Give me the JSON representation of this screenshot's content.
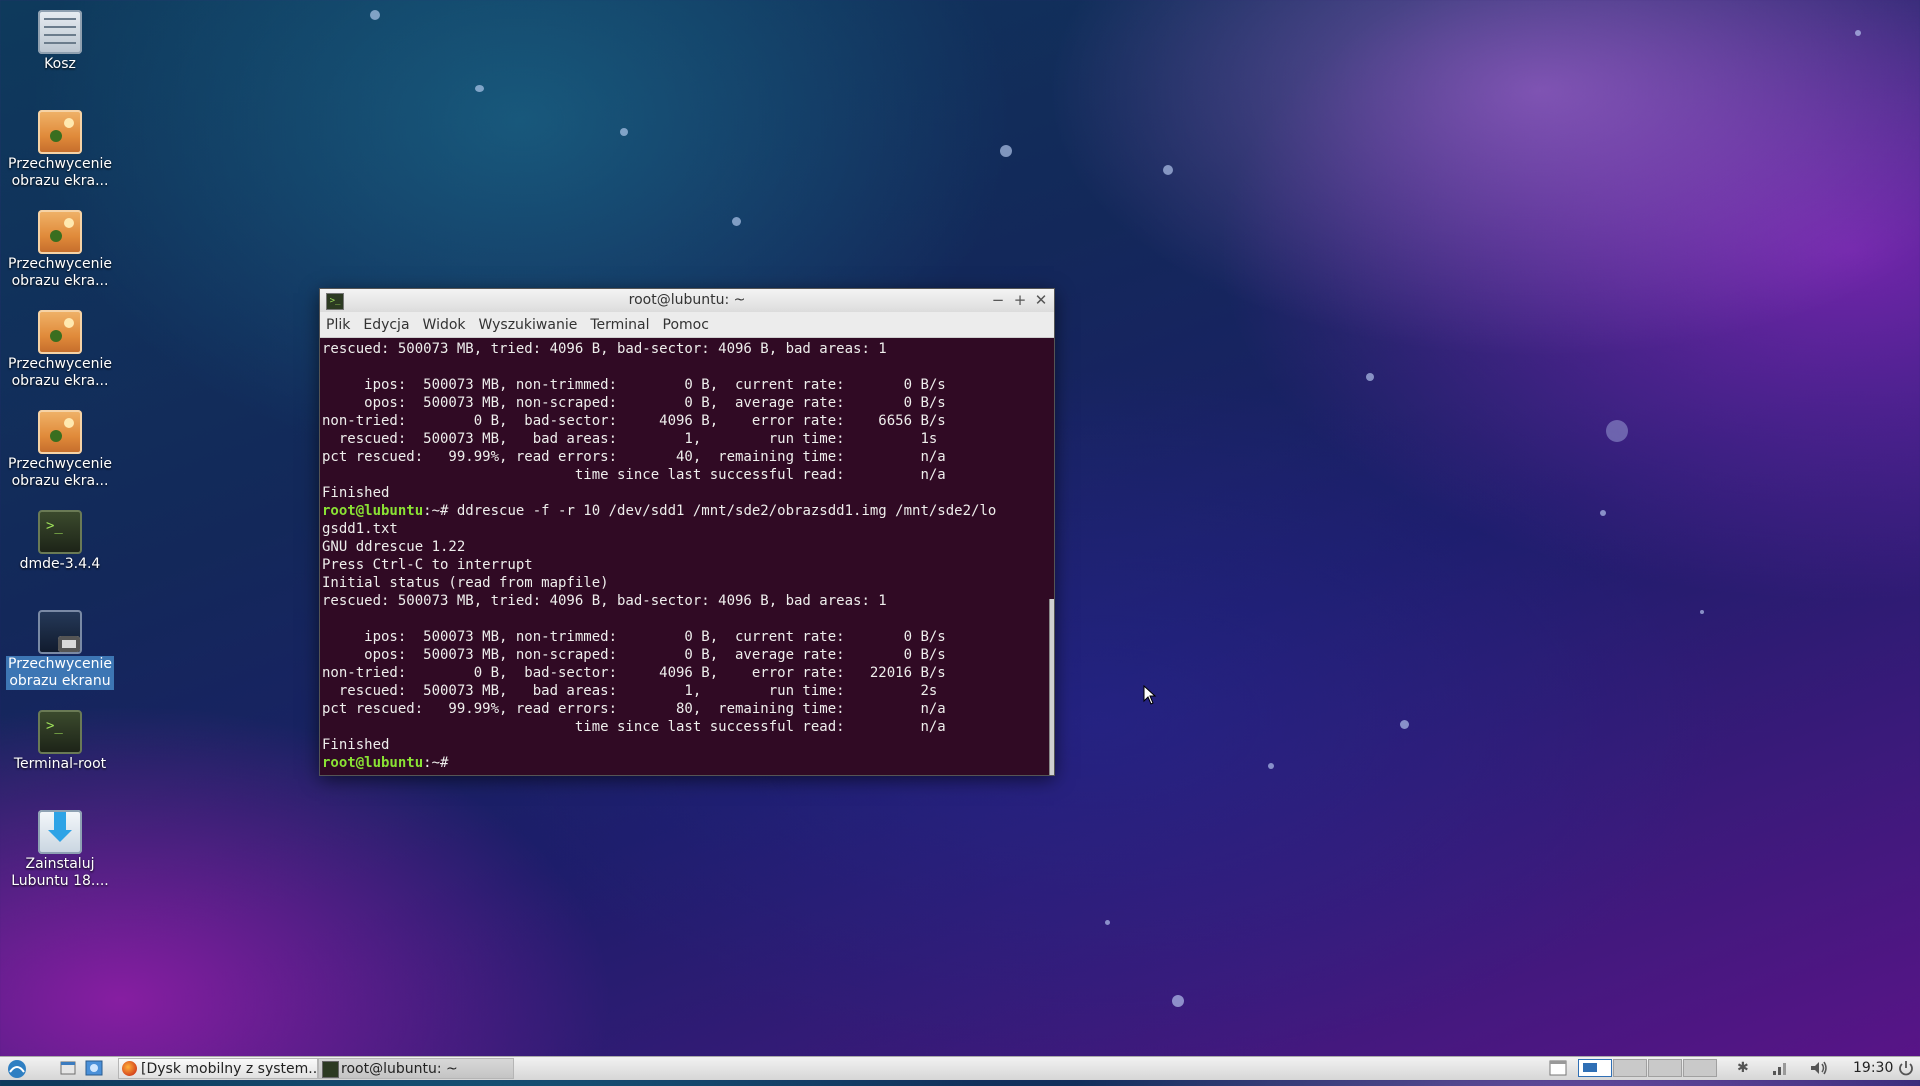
{
  "desktop": {
    "icons": [
      {
        "label": "Kosz"
      },
      {
        "label": "Przechwycenie obrazu ekra..."
      },
      {
        "label": "Przechwycenie obrazu ekra..."
      },
      {
        "label": "Przechwycenie obrazu ekra..."
      },
      {
        "label": "Przechwycenie obrazu ekra..."
      },
      {
        "label": "dmde-3.4.4"
      },
      {
        "label": "Przechwycenie obrazu ekranu"
      },
      {
        "label": "Terminal-root"
      },
      {
        "label": "Zainstaluj Lubuntu 18...."
      }
    ]
  },
  "terminal": {
    "title": "root@lubuntu: ~",
    "menu": [
      "Plik",
      "Edycja",
      "Widok",
      "Wyszukiwanie",
      "Terminal",
      "Pomoc"
    ],
    "lines": [
      {
        "text": "rescued: 500073 MB, tried: 4096 B, bad-sector: 4096 B, bad areas: 1"
      },
      {
        "text": ""
      },
      {
        "text": "     ipos:  500073 MB, non-trimmed:        0 B,  current rate:       0 B/s"
      },
      {
        "text": "     opos:  500073 MB, non-scraped:        0 B,  average rate:       0 B/s"
      },
      {
        "text": "non-tried:        0 B,  bad-sector:     4096 B,    error rate:    6656 B/s"
      },
      {
        "text": "  rescued:  500073 MB,   bad areas:        1,        run time:         1s"
      },
      {
        "text": "pct rescued:   99.99%, read errors:       40,  remaining time:         n/a"
      },
      {
        "text": "                              time since last successful read:         n/a"
      },
      {
        "text": "Finished"
      },
      {
        "prompt": "root@lubuntu",
        "text": ":~# ddrescue -f -r 10 /dev/sdd1 /mnt/sde2/obrazsdd1.img /mnt/sde2/lo"
      },
      {
        "text": "gsdd1.txt"
      },
      {
        "text": "GNU ddrescue 1.22"
      },
      {
        "text": "Press Ctrl-C to interrupt"
      },
      {
        "text": "Initial status (read from mapfile)"
      },
      {
        "text": "rescued: 500073 MB, tried: 4096 B, bad-sector: 4096 B, bad areas: 1"
      },
      {
        "text": ""
      },
      {
        "text": "     ipos:  500073 MB, non-trimmed:        0 B,  current rate:       0 B/s"
      },
      {
        "text": "     opos:  500073 MB, non-scraped:        0 B,  average rate:       0 B/s"
      },
      {
        "text": "non-tried:        0 B,  bad-sector:     4096 B,    error rate:   22016 B/s"
      },
      {
        "text": "  rescued:  500073 MB,   bad areas:        1,        run time:         2s"
      },
      {
        "text": "pct rescued:   99.99%, read errors:       80,  remaining time:         n/a"
      },
      {
        "text": "                              time since last successful read:         n/a"
      },
      {
        "text": "Finished"
      },
      {
        "prompt": "root@lubuntu",
        "text": ":~# "
      }
    ]
  },
  "taskbar": {
    "tasks": [
      {
        "label": "[Dysk mobilny z system..."
      },
      {
        "label": "root@lubuntu: ~"
      }
    ],
    "clock": "19:30"
  },
  "colors": {
    "terminal_bg": "#300a24",
    "terminal_fg": "#eeeeec",
    "prompt": "#8ae234",
    "selection": "#3d76b4"
  }
}
